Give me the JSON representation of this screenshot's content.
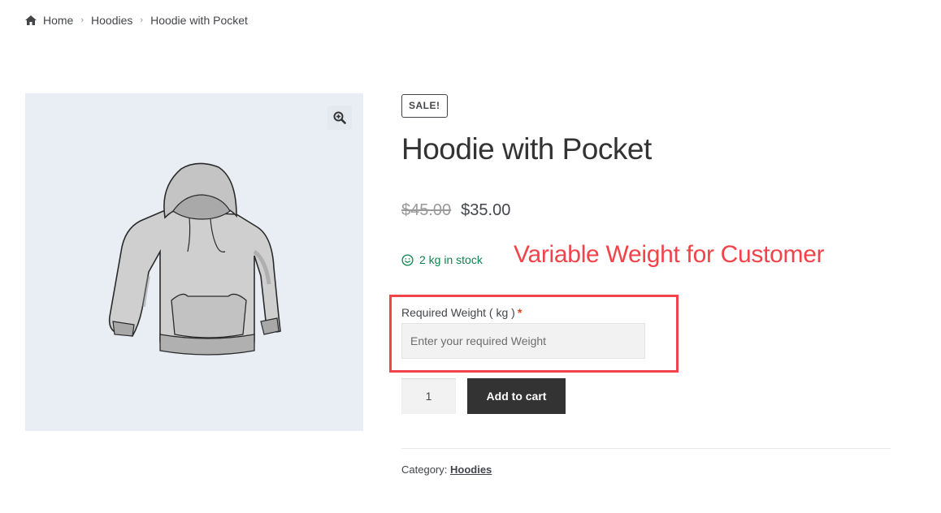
{
  "breadcrumb": {
    "home": "Home",
    "category": "Hoodies",
    "current": "Hoodie with Pocket",
    "separator": "›"
  },
  "gallery": {
    "image_subject": "gray hoodie with front pocket",
    "zoom_icon": "magnifier-plus-icon"
  },
  "product": {
    "badge": "SALE!",
    "title": "Hoodie with Pocket",
    "price_old": "$45.00",
    "price_new": "$35.00",
    "stock": "2 kg in stock",
    "stock_icon": "smile-icon"
  },
  "annotation": {
    "text": "Variable Weight for Customer",
    "color": "#f2434a"
  },
  "weight_field": {
    "label": "Required Weight ( kg )",
    "required_mark": "*",
    "placeholder": "Enter your required Weight",
    "value": ""
  },
  "cart": {
    "quantity": "1",
    "button_label": "Add to cart"
  },
  "meta": {
    "category_label": "Category:",
    "category_value": "Hoodies"
  },
  "colors": {
    "stock_green": "#0f834d",
    "button_dark": "#333333",
    "gallery_bg": "#e9eef5",
    "highlight_red": "#f2434a"
  }
}
